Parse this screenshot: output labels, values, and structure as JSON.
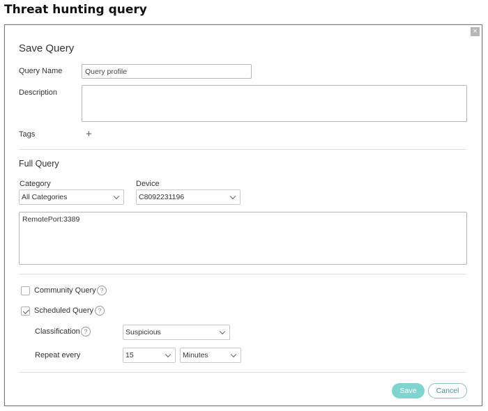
{
  "heading": "Threat hunting query",
  "dialog": {
    "close_label": "×",
    "title": "Save Query",
    "query_name": {
      "label": "Query Name",
      "value": "Query profile"
    },
    "description": {
      "label": "Description",
      "value": ""
    },
    "tags": {
      "label": "Tags",
      "add_glyph": "+"
    },
    "full_query": {
      "title": "Full Query",
      "category": {
        "label": "Category",
        "selected": "All Categories"
      },
      "device": {
        "label": "Device",
        "selected": "C8092231196"
      },
      "query_text": "RemotePort:3389"
    },
    "options": {
      "community_query": {
        "label": "Community Query",
        "checked": false
      },
      "scheduled_query": {
        "label": "Scheduled Query",
        "checked": true
      },
      "help_glyph": "?",
      "classification": {
        "label": "Classification",
        "selected": "Suspicious"
      },
      "repeat_every": {
        "label": "Repeat every",
        "interval": "15",
        "unit": "Minutes"
      }
    },
    "buttons": {
      "save": "Save",
      "cancel": "Cancel"
    }
  },
  "colors": {
    "save_button": "#7fd4d0",
    "cancel_text": "#4a8f95",
    "border": "#b4b4b4"
  }
}
